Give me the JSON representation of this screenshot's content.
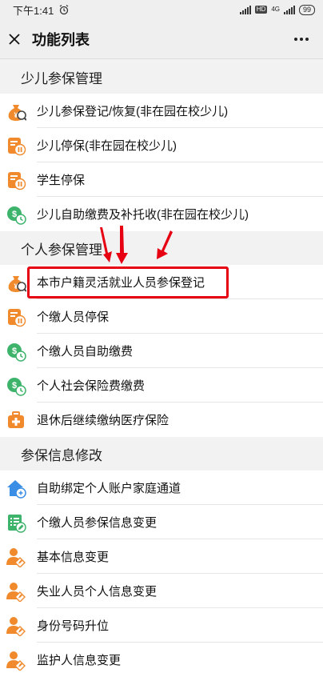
{
  "status_bar": {
    "time": "下午1:41",
    "hd": "HD",
    "network": "4G",
    "battery": "99"
  },
  "header": {
    "title": "功能列表"
  },
  "sections": [
    {
      "title": "少儿参保管理",
      "items": [
        {
          "label": "少儿参保登记/恢复(非在园在校少儿)",
          "icon": "money-bag-icon"
        },
        {
          "label": "少儿停保(非在园在校少儿)",
          "icon": "document-pause-icon"
        },
        {
          "label": "学生停保",
          "icon": "document-pause-icon"
        },
        {
          "label": "少儿自助缴费及补托收(非在园在校少儿)",
          "icon": "coin-clock-icon"
        }
      ]
    },
    {
      "title": "个人参保管理",
      "items": [
        {
          "label": "本市户籍灵活就业人员参保登记",
          "icon": "money-bag-icon"
        },
        {
          "label": "个缴人员停保",
          "icon": "document-pause-icon"
        },
        {
          "label": "个缴人员自助缴费",
          "icon": "coin-clock-icon"
        },
        {
          "label": "个人社会保险费缴费",
          "icon": "coin-clock-icon"
        },
        {
          "label": "退休后继续缴纳医疗保险",
          "icon": "medical-kit-icon"
        }
      ]
    },
    {
      "title": "参保信息修改",
      "items": [
        {
          "label": "自助绑定个人账户家庭通道",
          "icon": "home-link-icon"
        },
        {
          "label": "个缴人员参保信息变更",
          "icon": "edit-list-icon"
        },
        {
          "label": "基本信息变更",
          "icon": "user-edit-icon"
        },
        {
          "label": "失业人员个人信息变更",
          "icon": "user-edit-icon"
        },
        {
          "label": "身份号码升位",
          "icon": "user-edit-icon"
        },
        {
          "label": "监护人信息变更",
          "icon": "user-edit-icon"
        }
      ]
    }
  ],
  "colors": {
    "orange": "#f08a2c",
    "green": "#3db36b",
    "blue": "#3a8ee6",
    "highlight": "#e60012"
  }
}
